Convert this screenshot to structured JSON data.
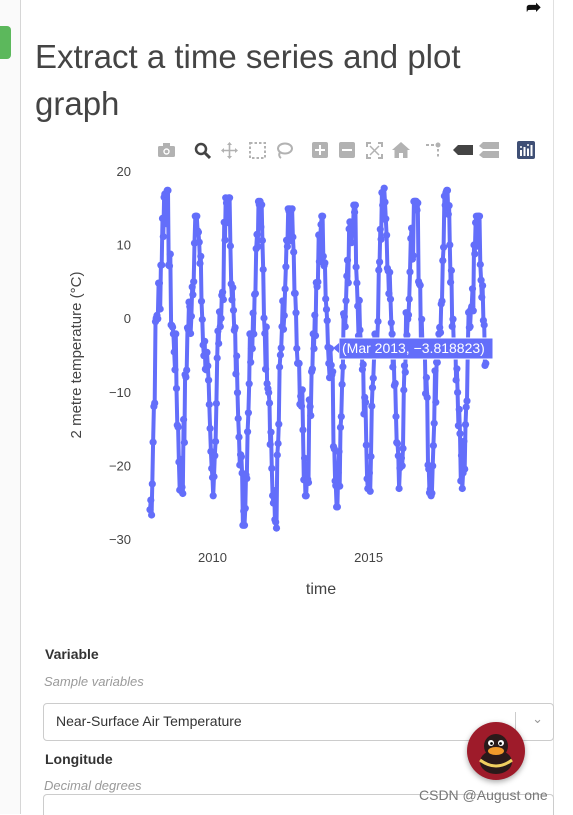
{
  "page": {
    "title": "Extract a time series and plot graph"
  },
  "modebar": {
    "icons": [
      "camera-icon",
      "zoom-icon",
      "pan-icon",
      "box-select-icon",
      "lasso-select-icon",
      "zoom-in-icon",
      "zoom-out-icon",
      "autoscale-icon",
      "reset-axes-icon",
      "spike-lines-icon",
      "hover-closest-icon",
      "hover-compare-icon",
      "plotly-logo-icon"
    ]
  },
  "chart_data": {
    "type": "line",
    "xlabel": "time",
    "ylabel": "2 metre temperature (°C)",
    "ylim": [
      -30,
      20
    ],
    "yticks": [
      "20",
      "10",
      "0",
      "−10",
      "−20",
      "−30"
    ],
    "xticks": [
      "2010",
      "2015"
    ],
    "x": [
      "2008-01",
      "2008-04",
      "2008-07",
      "2008-10",
      "2009-01",
      "2009-04",
      "2009-07",
      "2009-10",
      "2010-01",
      "2010-04",
      "2010-07",
      "2010-10",
      "2011-01",
      "2011-04",
      "2011-07",
      "2011-10",
      "2012-01",
      "2012-04",
      "2012-07",
      "2012-10",
      "2013-01",
      "2013-04",
      "2013-07",
      "2013-10",
      "2014-01",
      "2014-04",
      "2014-07",
      "2014-10",
      "2015-01",
      "2015-04",
      "2015-07",
      "2015-10",
      "2016-01",
      "2016-04",
      "2016-07",
      "2016-10",
      "2017-01",
      "2017-04",
      "2017-07",
      "2017-10",
      "2018-01",
      "2018-04",
      "2018-07",
      "2018-10"
    ],
    "series": [
      {
        "color": "#636efa",
        "values": [
          -25.8,
          2,
          17.5,
          -2,
          -22,
          0,
          14,
          -3,
          -22,
          1,
          16.5,
          -5,
          -26,
          -2,
          16,
          -5,
          -27.5,
          -1,
          15,
          -6,
          -22,
          -2,
          14,
          -4,
          -23.5,
          1,
          15.5,
          -3,
          -22,
          -1,
          17.8,
          -2,
          -21,
          2,
          16,
          -3,
          -22,
          0,
          17.5,
          -3,
          -21,
          1,
          14,
          -6
        ]
      }
    ],
    "hover_label": "(Mar 2013, −3.818823)"
  },
  "form": {
    "variable_label": "Variable",
    "variable_help": "Sample variables",
    "variable_value": "Near-Surface Air Temperature",
    "longitude_label": "Longitude",
    "longitude_help": "Decimal degrees"
  },
  "watermark": "CSDN @August one"
}
